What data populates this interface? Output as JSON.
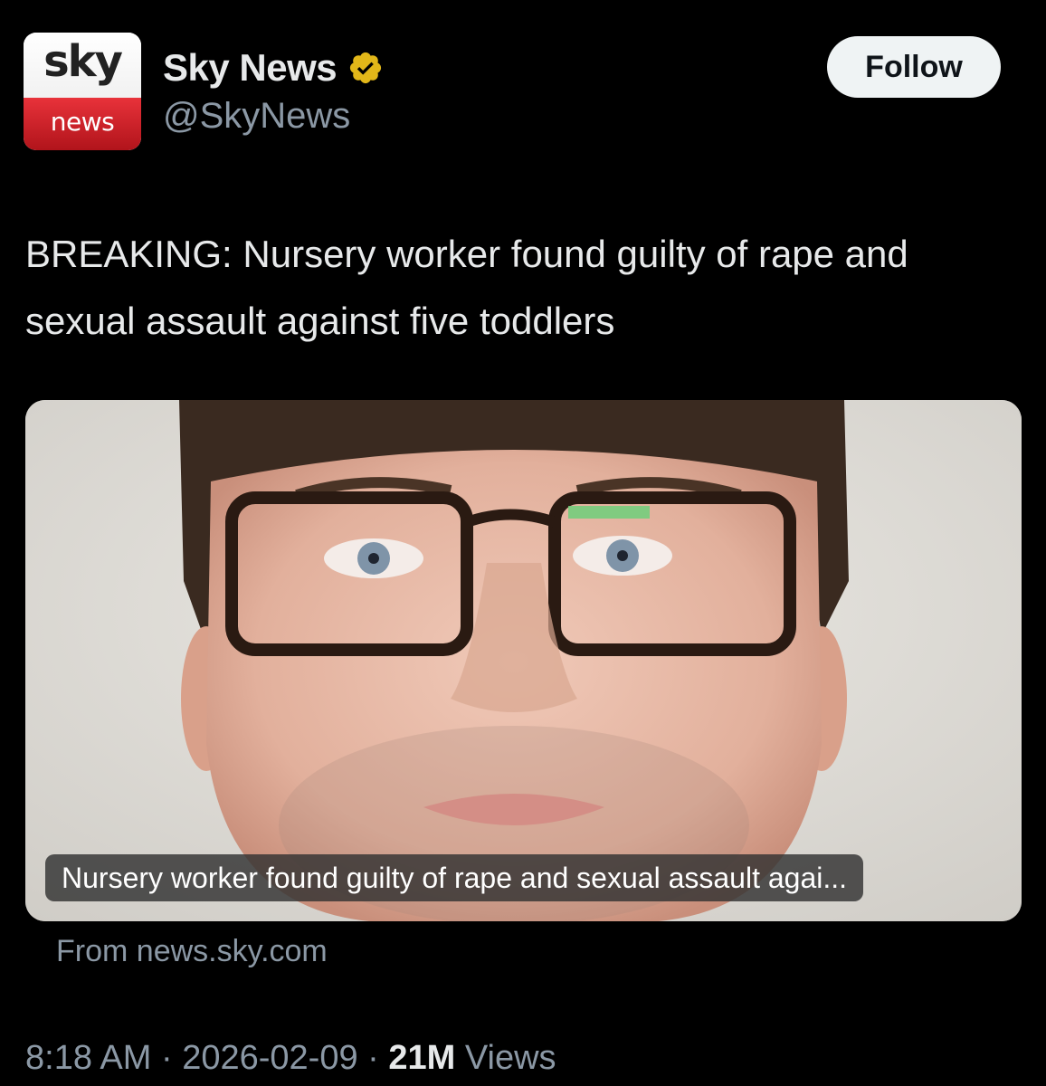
{
  "account": {
    "avatar_top_text": "sky",
    "avatar_bottom_text": "news",
    "display_name": "Sky News",
    "handle": "@SkyNews",
    "verified_icon": "verified-badge-icon",
    "follow_label": "Follow"
  },
  "tweet": {
    "text": "BREAKING: Nursery worker found guilty of rape and sexual assault against five toddlers"
  },
  "card": {
    "image_caption": "Nursery worker found guilty of rape and sexual assault agai...",
    "source_prefix": "From",
    "source_domain": "news.sky.com"
  },
  "meta": {
    "time": "8:18 AM",
    "separator": "·",
    "date": "2026-02-09",
    "views_count": "21M",
    "views_label": "Views"
  },
  "colors": {
    "background": "#000000",
    "text_primary": "#e7e9ea",
    "text_secondary": "#8b98a5",
    "verified_gold": "#e2b719",
    "sky_red": "#d3222a"
  }
}
